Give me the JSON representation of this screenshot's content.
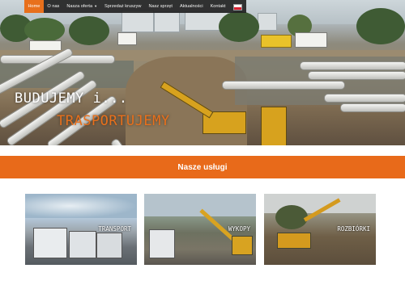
{
  "nav": {
    "items": [
      {
        "label": "Home",
        "active": true
      },
      {
        "label": "O nas",
        "active": false
      },
      {
        "label": "Nasza oferta",
        "active": false,
        "has_dropdown": true
      },
      {
        "label": "Sprzedaż kruszyw",
        "active": false
      },
      {
        "label": "Nasz sprzęt",
        "active": false
      },
      {
        "label": "Aktualności",
        "active": false
      },
      {
        "label": "Kontakt",
        "active": false
      }
    ],
    "language_flag": "pl-flag-icon"
  },
  "hero": {
    "line1": "BUDUJEMY  i...",
    "line2": "TRASPORTUJEMY"
  },
  "services": {
    "title": "Nasze usługi",
    "cards": [
      {
        "label": "TRANSPORT"
      },
      {
        "label": "WYKOPY"
      },
      {
        "label": "ROZBIÓRKI"
      }
    ]
  },
  "colors": {
    "accent": "#e86a1a",
    "nav_bg": "#232323"
  }
}
